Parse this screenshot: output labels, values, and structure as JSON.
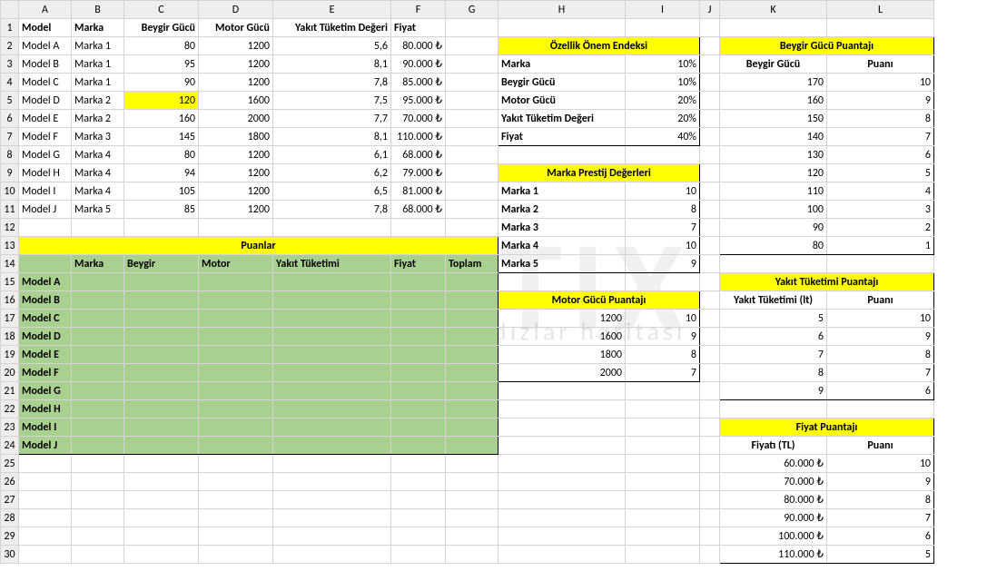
{
  "cols": [
    "A",
    "B",
    "C",
    "D",
    "E",
    "F",
    "G",
    "H",
    "I",
    "J",
    "K",
    "L"
  ],
  "headers": {
    "A": "Model",
    "B": "Marka",
    "C": "Beygir Gücü",
    "D": "Motor Gücü",
    "E": "Yakıt Tüketim Değeri",
    "F": "Fiyat"
  },
  "cars": [
    {
      "m": "Model A",
      "b": "Marka 1",
      "bg": "80",
      "mg": "1200",
      "yt": "5,6",
      "f": "80.000 ₺"
    },
    {
      "m": "Model B",
      "b": "Marka 1",
      "bg": "95",
      "mg": "1200",
      "yt": "8,1",
      "f": "90.000 ₺"
    },
    {
      "m": "Model C",
      "b": "Marka 1",
      "bg": "90",
      "mg": "1200",
      "yt": "7,8",
      "f": "85.000 ₺"
    },
    {
      "m": "Model D",
      "b": "Marka 2",
      "bg": "120",
      "mg": "1600",
      "yt": "7,5",
      "f": "95.000 ₺"
    },
    {
      "m": "Model E",
      "b": "Marka 2",
      "bg": "160",
      "mg": "2000",
      "yt": "7,7",
      "f": "70.000 ₺"
    },
    {
      "m": "Model F",
      "b": "Marka 3",
      "bg": "145",
      "mg": "1800",
      "yt": "8,1",
      "f": "110.000 ₺"
    },
    {
      "m": "Model G",
      "b": "Marka 4",
      "bg": "80",
      "mg": "1200",
      "yt": "6,1",
      "f": "68.000 ₺"
    },
    {
      "m": "Model H",
      "b": "Marka 4",
      "bg": "94",
      "mg": "1200",
      "yt": "6,2",
      "f": "79.000 ₺"
    },
    {
      "m": "Model I",
      "b": "Marka 4",
      "bg": "105",
      "mg": "1200",
      "yt": "6,5",
      "f": "81.000 ₺"
    },
    {
      "m": "Model J",
      "b": "Marka 5",
      "bg": "85",
      "mg": "1200",
      "yt": "7,8",
      "f": "68.000 ₺"
    }
  ],
  "onem_title": "Özellik Önem Endeksi",
  "onem": [
    {
      "k": "Marka",
      "v": "10%"
    },
    {
      "k": "Beygir Gücü",
      "v": "10%"
    },
    {
      "k": "Motor Gücü",
      "v": "20%"
    },
    {
      "k": "Yakıt Tüketim Değeri",
      "v": "20%"
    },
    {
      "k": "Fiyat",
      "v": "40%"
    }
  ],
  "prestij_title": "Marka Prestij Değerleri",
  "prestij": [
    {
      "k": "Marka 1",
      "v": "10"
    },
    {
      "k": "Marka 2",
      "v": "8"
    },
    {
      "k": "Marka 3",
      "v": "7"
    },
    {
      "k": "Marka 4",
      "v": "10"
    },
    {
      "k": "Marka 5",
      "v": "9"
    }
  ],
  "puanlar_title": "Puanlar",
  "puan_headers": {
    "b": "Marka",
    "c": "Beygir",
    "d": "Motor",
    "e": "Yakıt Tüketimi",
    "f": "Fiyat",
    "g": "Toplam"
  },
  "motor_title": "Motor Gücü Puantajı",
  "motor": [
    {
      "k": "1200",
      "v": "10"
    },
    {
      "k": "1600",
      "v": "9"
    },
    {
      "k": "1800",
      "v": "8"
    },
    {
      "k": "2000",
      "v": "7"
    }
  ],
  "beygir_title": "Beygir Gücü Puantajı",
  "beygir_h": {
    "k": "Beygir Gücü",
    "v": "Puanı"
  },
  "beygir": [
    {
      "k": "170",
      "v": "10"
    },
    {
      "k": "160",
      "v": "9"
    },
    {
      "k": "150",
      "v": "8"
    },
    {
      "k": "140",
      "v": "7"
    },
    {
      "k": "130",
      "v": "6"
    },
    {
      "k": "120",
      "v": "5"
    },
    {
      "k": "110",
      "v": "4"
    },
    {
      "k": "100",
      "v": "3"
    },
    {
      "k": "90",
      "v": "2"
    },
    {
      "k": "80",
      "v": "1"
    }
  ],
  "yakit_title": "Yakıt Tüketimi Puantajı",
  "yakit_h": {
    "k": "Yakıt Tüketimi (lt)",
    "v": "Puanı"
  },
  "yakit": [
    {
      "k": "5",
      "v": "10"
    },
    {
      "k": "6",
      "v": "9"
    },
    {
      "k": "7",
      "v": "8"
    },
    {
      "k": "8",
      "v": "7"
    },
    {
      "k": "9",
      "v": "6"
    }
  ],
  "fiyat_title": "Fiyat Puantajı",
  "fiyat_h": {
    "k": "Fiyatı (TL)",
    "v": "Puanı"
  },
  "fiyat": [
    {
      "k": "60.000 ₺",
      "v": "10"
    },
    {
      "k": "70.000 ₺",
      "v": "9"
    },
    {
      "k": "80.000 ₺",
      "v": "8"
    },
    {
      "k": "90.000 ₺",
      "v": "7"
    },
    {
      "k": "100.000 ₺",
      "v": "6"
    },
    {
      "k": "110.000 ₺",
      "v": "5"
    }
  ],
  "chart_data": {
    "type": "table",
    "title": "Car attribute scoring lookup tables",
    "tables": [
      {
        "name": "Özellik Önem Endeksi",
        "rows": [
          [
            "Marka",
            "10%"
          ],
          [
            "Beygir Gücü",
            "10%"
          ],
          [
            "Motor Gücü",
            "20%"
          ],
          [
            "Yakıt Tüketim Değeri",
            "20%"
          ],
          [
            "Fiyat",
            "40%"
          ]
        ]
      },
      {
        "name": "Marka Prestij Değerleri",
        "rows": [
          [
            "Marka 1",
            10
          ],
          [
            "Marka 2",
            8
          ],
          [
            "Marka 3",
            7
          ],
          [
            "Marka 4",
            10
          ],
          [
            "Marka 5",
            9
          ]
        ]
      },
      {
        "name": "Beygir Gücü Puantajı",
        "rows": [
          [
            170,
            10
          ],
          [
            160,
            9
          ],
          [
            150,
            8
          ],
          [
            140,
            7
          ],
          [
            130,
            6
          ],
          [
            120,
            5
          ],
          [
            110,
            4
          ],
          [
            100,
            3
          ],
          [
            90,
            2
          ],
          [
            80,
            1
          ]
        ]
      },
      {
        "name": "Motor Gücü Puantajı",
        "rows": [
          [
            1200,
            10
          ],
          [
            1600,
            9
          ],
          [
            1800,
            8
          ],
          [
            2000,
            7
          ]
        ]
      },
      {
        "name": "Yakıt Tüketimi Puantajı",
        "rows": [
          [
            5,
            10
          ],
          [
            6,
            9
          ],
          [
            7,
            8
          ],
          [
            8,
            7
          ],
          [
            9,
            6
          ]
        ]
      },
      {
        "name": "Fiyat Puantajı",
        "rows": [
          [
            60000,
            10
          ],
          [
            70000,
            9
          ],
          [
            80000,
            8
          ],
          [
            90000,
            7
          ],
          [
            100000,
            6
          ],
          [
            110000,
            5
          ]
        ]
      }
    ]
  }
}
